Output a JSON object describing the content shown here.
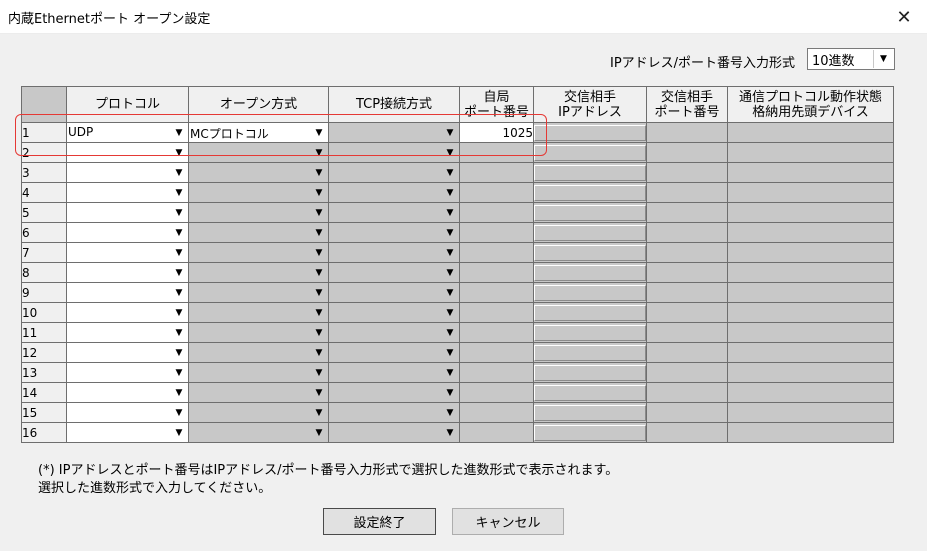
{
  "window": {
    "title": "内蔵Ethernetポート オープン設定",
    "close_glyph": "✕"
  },
  "format": {
    "label": "IPアドレス/ポート番号入力形式",
    "value": "10進数",
    "arrow": "▼"
  },
  "table": {
    "headers": {
      "protocol": "プロトコル",
      "open_method": "オープン方式",
      "tcp_method": "TCP接続方式",
      "local_port_1": "自局",
      "local_port_2": "ポート番号",
      "remote_ip_1": "交信相手",
      "remote_ip_2": "IPアドレス",
      "remote_port_1": "交信相手",
      "remote_port_2": "ポート番号",
      "device_1": "通信プロトコル動作状態",
      "device_2": "格納用先頭デバイス"
    },
    "arrow": "▼",
    "rows": [
      {
        "num": "1",
        "protocol": "UDP",
        "open_method": "MCプロトコル",
        "tcp_method": "",
        "local_port": "1025"
      },
      {
        "num": "2",
        "protocol": "",
        "open_method": "",
        "tcp_method": "",
        "local_port": ""
      },
      {
        "num": "3",
        "protocol": "",
        "open_method": "",
        "tcp_method": "",
        "local_port": ""
      },
      {
        "num": "4",
        "protocol": "",
        "open_method": "",
        "tcp_method": "",
        "local_port": ""
      },
      {
        "num": "5",
        "protocol": "",
        "open_method": "",
        "tcp_method": "",
        "local_port": ""
      },
      {
        "num": "6",
        "protocol": "",
        "open_method": "",
        "tcp_method": "",
        "local_port": ""
      },
      {
        "num": "7",
        "protocol": "",
        "open_method": "",
        "tcp_method": "",
        "local_port": ""
      },
      {
        "num": "8",
        "protocol": "",
        "open_method": "",
        "tcp_method": "",
        "local_port": ""
      },
      {
        "num": "9",
        "protocol": "",
        "open_method": "",
        "tcp_method": "",
        "local_port": ""
      },
      {
        "num": "10",
        "protocol": "",
        "open_method": "",
        "tcp_method": "",
        "local_port": ""
      },
      {
        "num": "11",
        "protocol": "",
        "open_method": "",
        "tcp_method": "",
        "local_port": ""
      },
      {
        "num": "12",
        "protocol": "",
        "open_method": "",
        "tcp_method": "",
        "local_port": ""
      },
      {
        "num": "13",
        "protocol": "",
        "open_method": "",
        "tcp_method": "",
        "local_port": ""
      },
      {
        "num": "14",
        "protocol": "",
        "open_method": "",
        "tcp_method": "",
        "local_port": ""
      },
      {
        "num": "15",
        "protocol": "",
        "open_method": "",
        "tcp_method": "",
        "local_port": ""
      },
      {
        "num": "16",
        "protocol": "",
        "open_method": "",
        "tcp_method": "",
        "local_port": ""
      }
    ]
  },
  "note": {
    "line1": "(*) IPアドレスとポート番号はIPアドレス/ポート番号入力形式で選択した進数形式で表示されます。",
    "line2": "選択した進数形式で入力してください。"
  },
  "buttons": {
    "ok": "設定終了",
    "cancel": "キャンセル"
  },
  "colors": {
    "highlight": "#e53935",
    "disabled_cell": "#c8c8c8",
    "grid_line": "#6e6e6e"
  }
}
